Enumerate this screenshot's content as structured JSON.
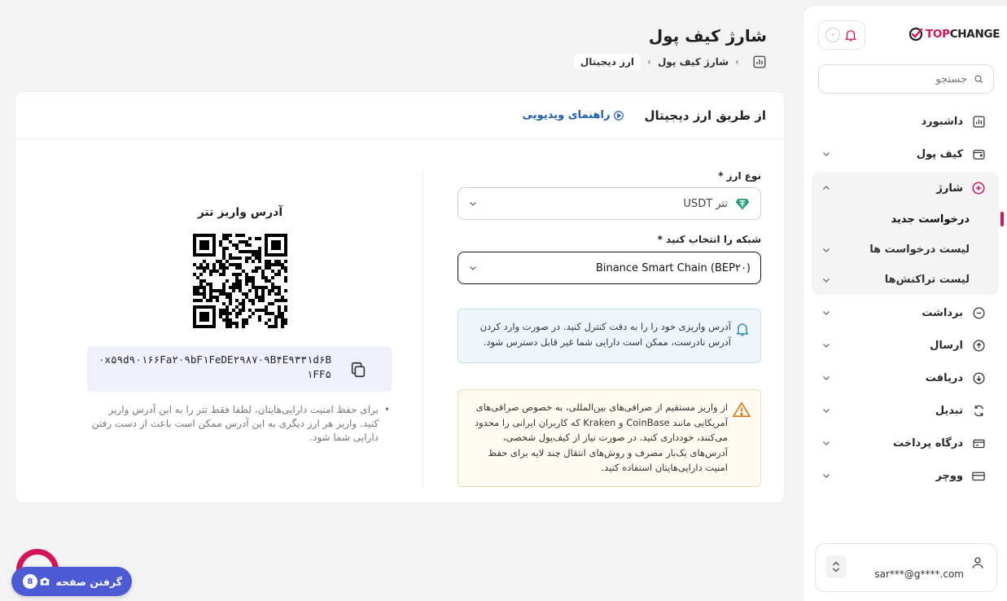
{
  "brand": {
    "name_prefix": "TOP",
    "name_suffix": "CHANGE",
    "accent": "#d4145a"
  },
  "header": {
    "notif_count": "۰",
    "search_placeholder": "جستجو"
  },
  "sidebar": {
    "items": [
      {
        "label": "داشبورد",
        "icon": "dashboard-icon"
      },
      {
        "label": "کیف پول",
        "icon": "wallet-icon"
      },
      {
        "label": "شارژ",
        "icon": "plus-circle-icon"
      },
      {
        "label": "برداشت",
        "icon": "minus-circle-icon"
      },
      {
        "label": "ارسال",
        "icon": "arrow-up-circle-icon"
      },
      {
        "label": "دریافت",
        "icon": "arrow-down-circle-icon"
      },
      {
        "label": "تبدیل",
        "icon": "refresh-icon"
      },
      {
        "label": "درگاه پرداخت",
        "icon": "card-icon"
      },
      {
        "label": "ووچر",
        "icon": "voucher-icon"
      }
    ],
    "charge_sub": [
      "درخواست جدید",
      "لیست درخواست ها",
      "لیست تراکنش‌ها"
    ],
    "user_email": "sar***@g****.com"
  },
  "page": {
    "title": "شارژ کیف پول",
    "breadcrumb": [
      "شارژ کیف پول",
      "ارز دیجیتال"
    ]
  },
  "card": {
    "title": "از طریق ارز دیجیتال",
    "video_link": "راهنمای ویدیویی",
    "currency_label": "نوع ارز *",
    "currency_value": "تتر USDT",
    "network_label": "شبکه را انتخاب کنید *",
    "network_value": "Binance Smart Chain (BEP۲۰)",
    "info_text": "آدرس واریزی خود را را به دقت کنترل کنید. در صورت وارد کردن آدرس نادرست، ممکن است دارایی شما غیر قابل دسترس شود.",
    "warn_text": "از واریز مستقیم از صرافی‌های بین‌المللی، به خصوص صرافی‌های آمریکایی مانند CoinBase و Kraken که کاربران ایرانی را محدود می‌کنند، خودداری کنید. در صورت نیاز از کیف‌پول شخصی، آدرس‌های یک‌بار مصرف و روش‌های انتقال چند لایه برای حفظ امنیت دارایی‌هایتان استفاده کنید.",
    "address_title": "آدرس واریز تتر",
    "address": "۰x۵۹d۹۰۱۶۶Fa۲۰۹bF۱FeDE۲۹۸۷۰۹B۴E۹۳۳۱d۶B۱FF۵",
    "note": "برای حفظ امنیت دارایی‌هایتان، لطفا فقط تتر را به این آدرس واریز کنید. واریز هر ارز دیگری به این آدرس ممکن است باعث از دست رفتن دارایی شما شود."
  },
  "capture": {
    "label": "گرفتن صفحه",
    "badge": "8"
  }
}
